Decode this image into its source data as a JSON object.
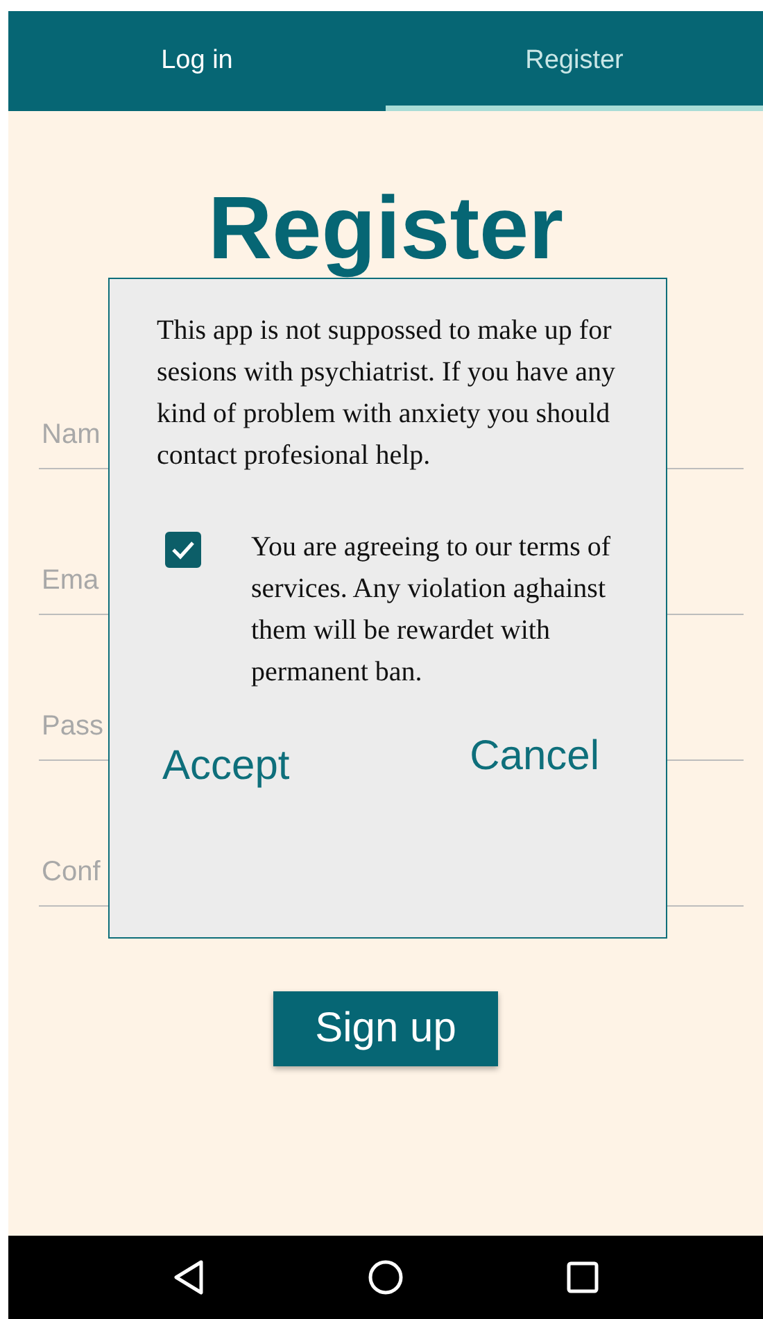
{
  "tabs": [
    {
      "label": "Log in",
      "selected": false
    },
    {
      "label": "Register",
      "selected": true
    }
  ],
  "title": "Register",
  "fields": [
    {
      "placeholder": "Nam"
    },
    {
      "placeholder": "Ema"
    },
    {
      "placeholder": "Pass"
    },
    {
      "placeholder": "Conf"
    }
  ],
  "sign_up_button": "Sign up",
  "dialog": {
    "message": "This  app is not suppossed to make up for sesions with psychiatrist. If you have any kind of problem with anxiety you should contact profesional help.",
    "terms": {
      "checked": true,
      "label": "You are agreeing to our terms of services. Any violation aghainst them will be rewardet with permanent ban."
    },
    "accept": "Accept",
    "cancel": "Cancel"
  }
}
